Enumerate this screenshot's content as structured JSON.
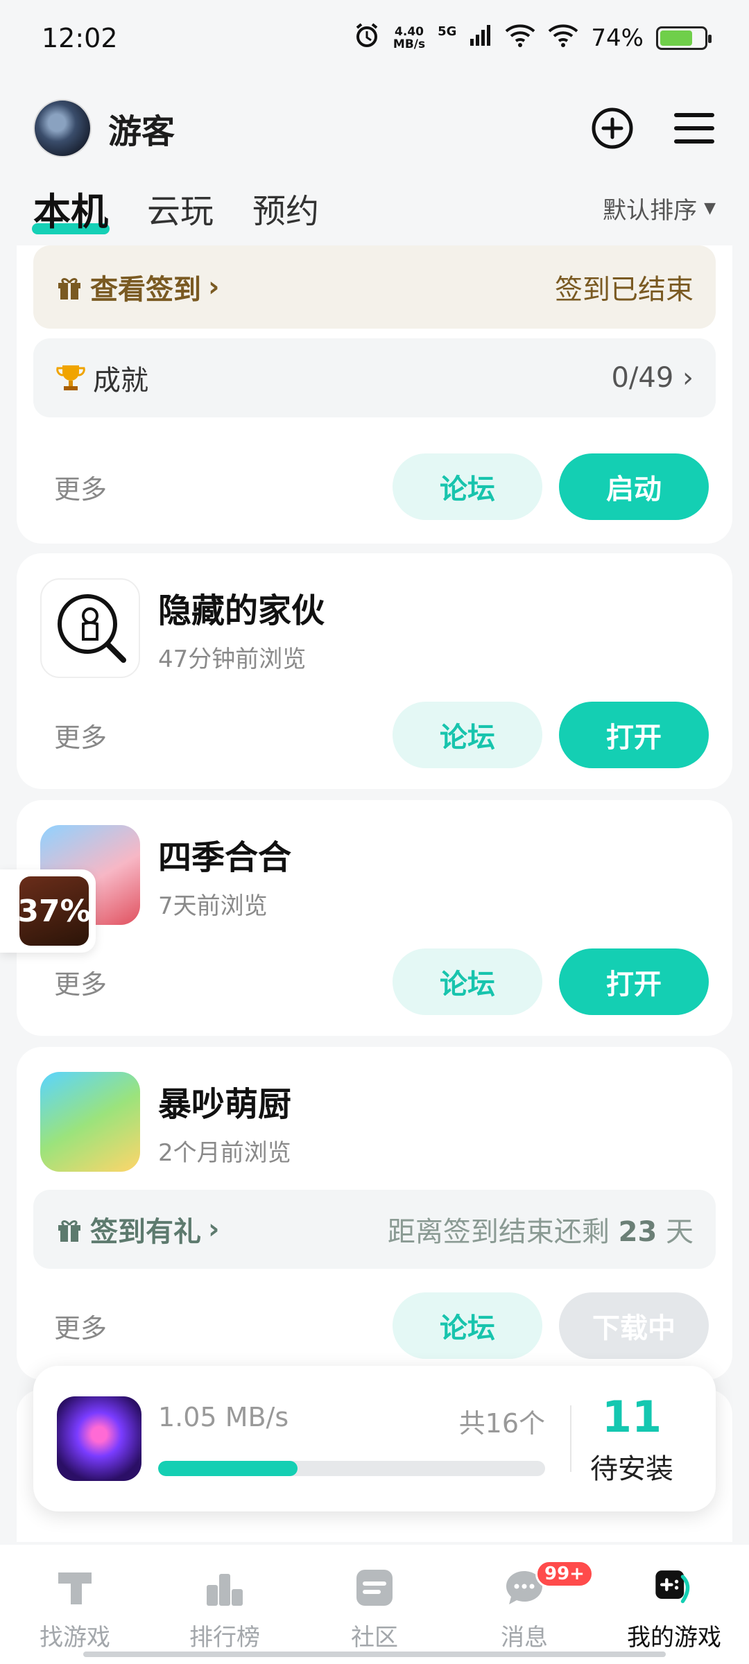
{
  "status_bar": {
    "time": "12:02",
    "net_speed_value": "4.40",
    "net_speed_unit": "MB/s",
    "network": "5G",
    "battery": "74%",
    "battery_level": 0.74
  },
  "header": {
    "user_name": "游客"
  },
  "tabs": {
    "items": [
      {
        "label": "本机"
      },
      {
        "label": "云玩"
      },
      {
        "label": "预约"
      }
    ],
    "sort_label": "默认排序"
  },
  "card1": {
    "checkin_label": "查看签到",
    "checkin_status": "签到已结束",
    "achievement_label": "成就",
    "achievement_progress": "0/49",
    "more": "更多",
    "forum": "论坛",
    "action": "启动"
  },
  "games": [
    {
      "title": "隐藏的家伙",
      "subtitle": "47分钟前浏览",
      "more": "更多",
      "forum": "论坛",
      "action": "打开"
    },
    {
      "title": "四季合合",
      "subtitle": "7天前浏览",
      "more": "更多",
      "forum": "论坛",
      "action": "打开"
    },
    {
      "title": "暴吵萌厨",
      "subtitle": "2个月前浏览",
      "more": "更多",
      "forum": "论坛",
      "action": "下载中",
      "checkin_label": "签到有礼",
      "checkin_prefix": "距离签到结束还剩",
      "checkin_days": "23",
      "checkin_suffix": "天"
    }
  ],
  "float_bubble": {
    "percent": "37%"
  },
  "download_panel": {
    "speed": "1.05 MB/s",
    "total": "共16个",
    "progress": 0.36,
    "pending_count": "11",
    "pending_label": "待安装"
  },
  "bottom_nav": {
    "items": [
      {
        "label": "找游戏"
      },
      {
        "label": "排行榜"
      },
      {
        "label": "社区"
      },
      {
        "label": "消息"
      },
      {
        "label": "我的游戏"
      }
    ],
    "badge": "99+"
  },
  "colors": {
    "accent": "#14cfb3",
    "accent_light": "#e4f8f5",
    "checkin_text": "#7a5a22"
  }
}
